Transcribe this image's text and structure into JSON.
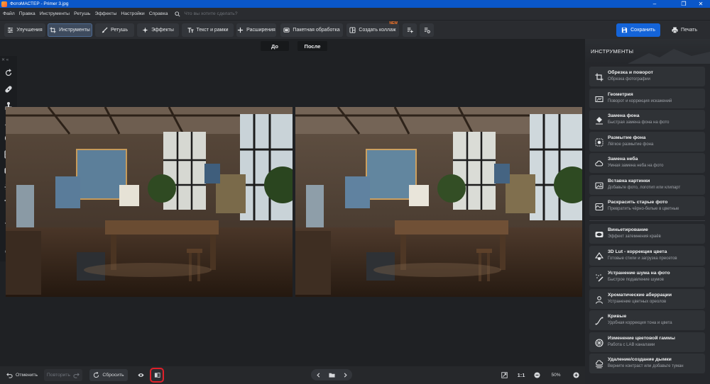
{
  "window": {
    "title": "ФотоМАСТЕР - Primer 3.jpg",
    "controls": [
      "–",
      "❐",
      "✕"
    ]
  },
  "menu": {
    "items": [
      "Файл",
      "Правка",
      "Инструменты",
      "Ретушь",
      "Эффекты",
      "Настройки",
      "Справка"
    ],
    "search_placeholder": "Что вы хотите сделать?"
  },
  "toolbar": {
    "tabs": [
      {
        "label": "Улучшения",
        "icon": "sliders-icon"
      },
      {
        "label": "Инструменты",
        "icon": "crop-icon",
        "active": true
      },
      {
        "label": "Ретушь",
        "icon": "brush-icon"
      },
      {
        "label": "Эффекты",
        "icon": "sparkle-icon"
      },
      {
        "label": "Текст и рамки",
        "icon": "text-icon"
      },
      {
        "label": "Расширения",
        "icon": "plus-icon"
      }
    ],
    "batch_label": "Пакетная обработка",
    "collage_label": "Создать коллаж",
    "collage_badge": "NEW",
    "save_label": "Сохранить",
    "print_label": "Печать"
  },
  "compare": {
    "before_label": "До",
    "after_label": "После"
  },
  "right_panel": {
    "title": "ИНСТРУМЕНТЫ",
    "items": [
      {
        "title": "Обрезка и поворот",
        "subtitle": "Обрезка фотографии",
        "icon": "crop-icon"
      },
      {
        "title": "Геометрия",
        "subtitle": "Поворот и коррекция искажений",
        "icon": "geometry-icon"
      },
      {
        "title": "Замена фона",
        "subtitle": "Быстрая замена фона на фото",
        "icon": "bucket-icon"
      },
      {
        "title": "Размытие фона",
        "subtitle": "Лёгкое размытие фона",
        "icon": "blur-icon"
      },
      {
        "title": "Замена неба",
        "subtitle": "Умная замена неба на фото",
        "icon": "cloud-icon"
      },
      {
        "title": "Вставка картинки",
        "subtitle": "Добавьте фото, логотип или клипарт",
        "icon": "image-icon"
      },
      {
        "title": "Раскрасить старые фото",
        "subtitle": "Превратить чёрно-белые в цветные",
        "icon": "palette-icon"
      },
      {
        "title": "Виньетирование",
        "subtitle": "Эффект затемнения краёв",
        "icon": "vignette-icon"
      },
      {
        "title": "3D Lut - коррекция цвета",
        "subtitle": "Готовые стили и загрузка пресетов",
        "icon": "lut-icon"
      },
      {
        "title": "Устранение шума на фото",
        "subtitle": "Быстрое подавление шумов",
        "icon": "denoise-icon"
      },
      {
        "title": "Хроматические аберрации",
        "subtitle": "Устранение цветных ореолов",
        "icon": "aberration-icon"
      },
      {
        "title": "Кривые",
        "subtitle": "Удобная коррекция тона и цвета",
        "icon": "curves-icon"
      },
      {
        "title": "Изменение цветовой гаммы",
        "subtitle": "Работа с LAB каналами",
        "icon": "color-wheel-icon"
      },
      {
        "title": "Удаление/создание дымки",
        "subtitle": "Верните контраст или добавьте туман",
        "icon": "haze-icon"
      }
    ]
  },
  "bottom": {
    "undo_label": "Отменить",
    "redo_label": "Повторить",
    "reset_label": "Сбросить",
    "zoom_1to1": "1:1",
    "zoom_value": "50%"
  }
}
